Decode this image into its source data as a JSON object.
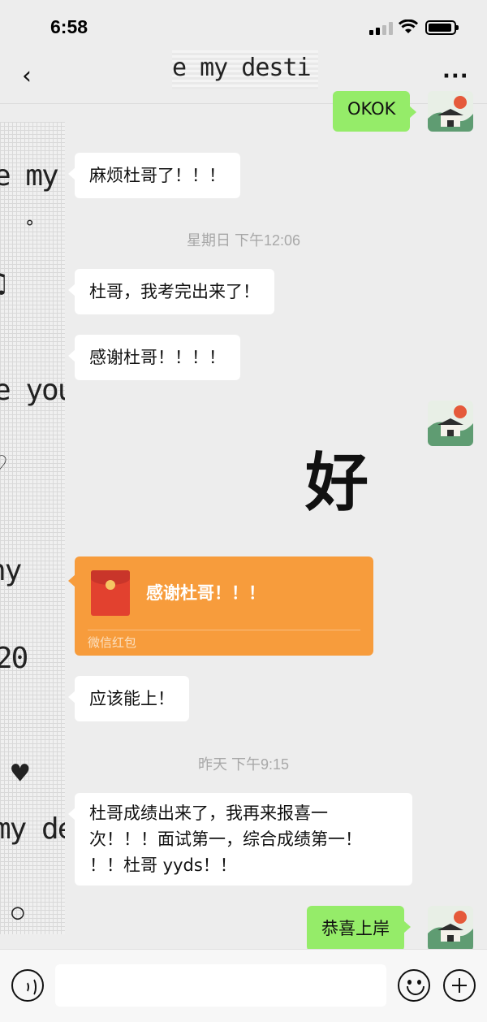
{
  "status_bar": {
    "time": "6:58"
  },
  "header": {
    "title": "e my desti"
  },
  "background_text": [
    "e my",
    "°",
    "♫",
    "e you",
    "♡",
    "ny",
    "20",
    "♥",
    "my de",
    "○"
  ],
  "messages": [
    {
      "type": "out",
      "text": "OKOK"
    },
    {
      "type": "in",
      "text": "麻烦杜哥了！！！"
    },
    {
      "type": "time",
      "text": "星期日 下午12:06"
    },
    {
      "type": "in",
      "text": "杜哥，我考完出来了！"
    },
    {
      "type": "in",
      "text": "感谢杜哥！！！！"
    },
    {
      "type": "sticker",
      "text": "好"
    },
    {
      "type": "redpacket",
      "text": "感谢杜哥！！！",
      "label": "微信红包"
    },
    {
      "type": "in",
      "text": "应该能上！"
    },
    {
      "type": "time",
      "text": "昨天 下午9:15"
    },
    {
      "type": "in",
      "lines": [
        "杜哥成绩出来了，我再来报喜一",
        "次！！！面试第一，综合成绩第一！",
        "！！杜哥 yyds！！"
      ]
    },
    {
      "type": "out",
      "text": "恭喜上岸"
    }
  ],
  "input_bar": {
    "value": "",
    "placeholder": ""
  },
  "colors": {
    "bubble_out": "#95ec69",
    "bubble_in": "#ffffff",
    "redpacket": "#f79c3c",
    "background": "#ededed"
  }
}
